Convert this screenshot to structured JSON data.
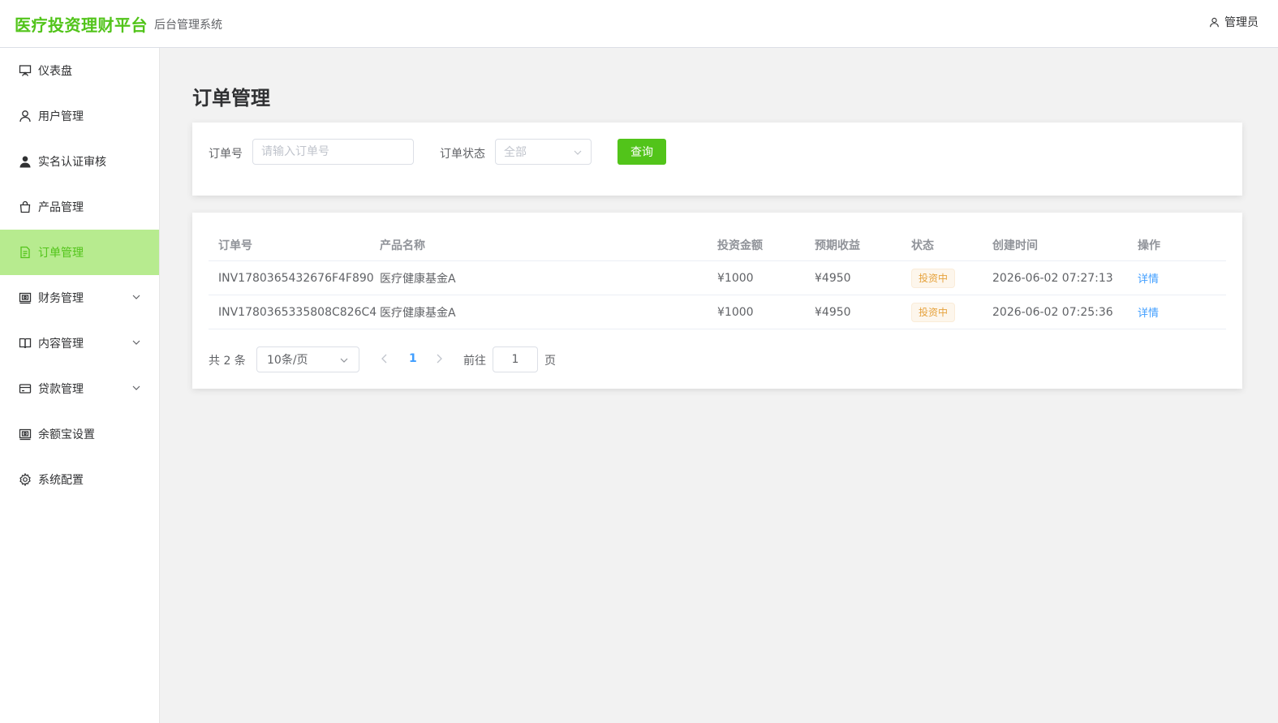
{
  "header": {
    "brand": "医疗投资理财平台",
    "subtitle": "后台管理系统",
    "user_label": "管理员"
  },
  "sidebar": {
    "items": [
      {
        "label": "仪表盘",
        "icon": "easel-icon",
        "active": false,
        "expandable": false
      },
      {
        "label": "用户管理",
        "icon": "user-icon",
        "active": false,
        "expandable": false
      },
      {
        "label": "实名认证审核",
        "icon": "user-filled-icon",
        "active": false,
        "expandable": false
      },
      {
        "label": "产品管理",
        "icon": "shopping-bag-icon",
        "active": false,
        "expandable": false
      },
      {
        "label": "订单管理",
        "icon": "document-icon",
        "active": true,
        "expandable": false
      },
      {
        "label": "财务管理",
        "icon": "wallet-icon",
        "active": false,
        "expandable": true
      },
      {
        "label": "内容管理",
        "icon": "book-icon",
        "active": false,
        "expandable": true
      },
      {
        "label": "贷款管理",
        "icon": "credit-card-icon",
        "active": false,
        "expandable": true
      },
      {
        "label": "余额宝设置",
        "icon": "wallet-icon",
        "active": false,
        "expandable": false
      },
      {
        "label": "系统配置",
        "icon": "gear-icon",
        "active": false,
        "expandable": false
      }
    ]
  },
  "page": {
    "title": "订单管理"
  },
  "filters": {
    "order_no_label": "订单号",
    "order_no_placeholder": "请输入订单号",
    "order_no_value": "",
    "status_label": "订单状态",
    "status_value": "全部",
    "query_label": "查询"
  },
  "table": {
    "columns": [
      "订单号",
      "产品名称",
      "投资金额",
      "预期收益",
      "状态",
      "创建时间",
      "操作"
    ],
    "rows": [
      {
        "order_no": "INV1780365432676F4F890",
        "product": "医疗健康基金A",
        "amount": "¥1000",
        "expected": "¥4950",
        "status": "投资中",
        "created": "2026-06-02 07:27:13",
        "action": "详情"
      },
      {
        "order_no": "INV1780365335808C826C4",
        "product": "医疗健康基金A",
        "amount": "¥1000",
        "expected": "¥4950",
        "status": "投资中",
        "created": "2026-06-02 07:25:36",
        "action": "详情"
      }
    ]
  },
  "pagination": {
    "total_text": "共 2 条",
    "page_size": "10条/页",
    "current_page": "1",
    "goto_label": "前往",
    "goto_value": "1",
    "page_suffix": "页"
  },
  "colors": {
    "brand": "#52c41a",
    "active_bg": "#b7eb8f",
    "link": "#409eff",
    "warning": "#e6a23c"
  }
}
